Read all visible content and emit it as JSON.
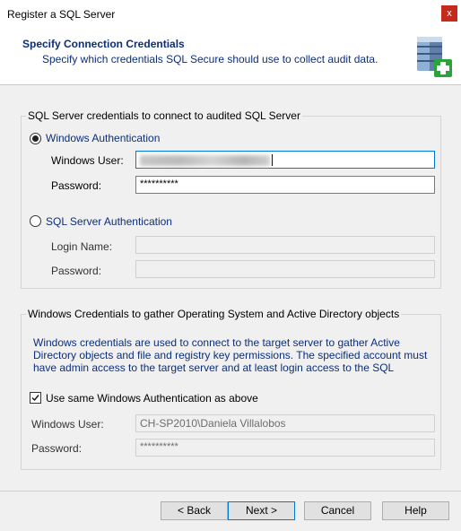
{
  "window": {
    "title": "Register a SQL Server",
    "close_glyph": "x"
  },
  "header": {
    "title": "Specify Connection Credentials",
    "subtitle": "Specify which credentials SQL Secure should use to collect audit data.",
    "icon": "database-add-icon"
  },
  "sql_group": {
    "legend": "SQL Server credentials to connect to audited SQL Server",
    "windows_auth": {
      "label": "Windows Authentication",
      "selected": true,
      "user_label": "Windows User:",
      "user_value_redacted": true,
      "password_label": "Password:",
      "password_value": "**********"
    },
    "sql_auth": {
      "label": "SQL Server Authentication",
      "selected": false,
      "login_label": "Login Name:",
      "login_value": "",
      "password_label": "Password:",
      "password_value": ""
    }
  },
  "win_group": {
    "legend": "Windows Credentials to gather Operating System and Active Directory objects",
    "info_lines": [
      "Windows credentials are used to connect to the target server to gather Active",
      "Directory objects and file and registry key permissions. The specified account must",
      "have admin access to the target server and at least login access to the SQL"
    ],
    "same_auth_label": "Use same Windows Authentication as above",
    "same_auth_checked": true,
    "user_label": "Windows User:",
    "user_value": "CH-SP2010\\Daniela Villalobos",
    "password_label": "Password:",
    "password_value": "**********"
  },
  "buttons": {
    "back": "< Back",
    "next": "Next >",
    "cancel": "Cancel",
    "help": "Help"
  },
  "colors": {
    "accent": "#0078d7",
    "header_text": "#0b2e7a",
    "close": "#c42b1c"
  }
}
